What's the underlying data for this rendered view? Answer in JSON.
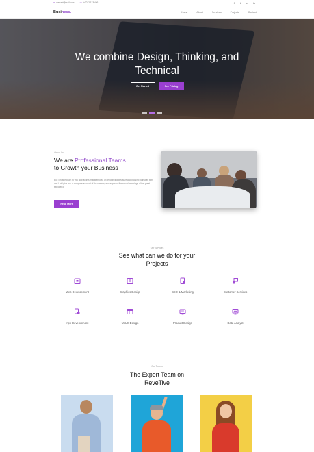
{
  "topbar": {
    "email": "contact@mail.com",
    "phone": "+0012 123 456",
    "social": [
      "f",
      "t",
      "v",
      "in"
    ]
  },
  "nav": {
    "logo_main": "Busi",
    "logo_accent": "ness.",
    "menu": [
      "Home",
      "About",
      "Services",
      "Projects",
      "Contact"
    ]
  },
  "hero": {
    "title_line1": "We combine Design, Thinking, and",
    "title_line2": "Technical",
    "primary_button": "Get Started",
    "secondary_button": "See Pricing"
  },
  "about": {
    "label": "About Us",
    "title_prefix": "We are ",
    "title_highlight": "Professional Teams",
    "title_line2": "to Growth your Business",
    "text": "But I must explain to you how all this mistaken idea of denouncing pleasure and praising pain was born and I will give you a complete account of the system, and expound the actual teachings of the great explorer of",
    "button": "Read More"
  },
  "services": {
    "label": "Our Services",
    "title_line1": "See what can we do for your",
    "title_line2": "Projects",
    "items": [
      {
        "label": "Web Development",
        "icon": "web-icon"
      },
      {
        "label": "Graphics Design",
        "icon": "graphics-icon"
      },
      {
        "label": "SEO & Marketing",
        "icon": "seo-icon"
      },
      {
        "label": "Customer Services",
        "icon": "support-icon"
      },
      {
        "label": "App Development",
        "icon": "app-icon"
      },
      {
        "label": "UI/UX Design",
        "icon": "uiux-icon"
      },
      {
        "label": "Product Design",
        "icon": "product-icon"
      },
      {
        "label": "Data Analyst",
        "icon": "analytics-icon"
      }
    ]
  },
  "team": {
    "label": "Our Teams",
    "title_line1": "The Expert Team on",
    "title_line2": "ReveTive"
  },
  "colors": {
    "accent": "#9a3fd0",
    "icon": "#a04bd6"
  }
}
